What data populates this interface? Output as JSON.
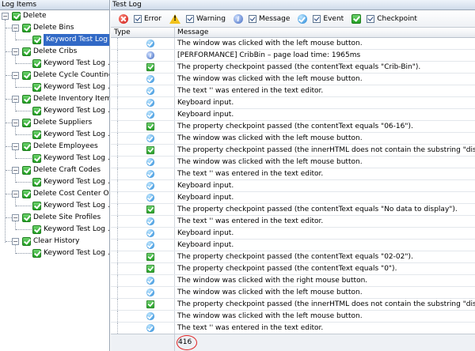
{
  "left_pane": {
    "title": "Log Items",
    "root": "Delete",
    "items": [
      {
        "label": "Delete Bins",
        "child": "Keyword Test Log ..."
      },
      {
        "label": "Delete Cribs",
        "child": "Keyword Test Log ..."
      },
      {
        "label": "Delete Cycle Counting ...",
        "child": "Keyword Test Log ..."
      },
      {
        "label": "Delete Inventory Items",
        "child": "Keyword Test Log ..."
      },
      {
        "label": "Delete Suppliers",
        "child": "Keyword Test Log ..."
      },
      {
        "label": "Delete Employees",
        "child": "Keyword Test Log ..."
      },
      {
        "label": "Delete Craft Codes",
        "child": "Keyword Test Log ..."
      },
      {
        "label": "Delete Cost Center Ones",
        "child": "Keyword Test Log ..."
      },
      {
        "label": "Delete Site Profiles",
        "child": "Keyword Test Log ..."
      },
      {
        "label": "Clear History",
        "child": "Keyword Test Log ..."
      }
    ],
    "selected_index": 0
  },
  "right_pane": {
    "title": "Test Log",
    "filters": [
      {
        "label": "Error",
        "icon": "error-icon",
        "checked": true
      },
      {
        "label": "Warning",
        "icon": "warning-icon",
        "checked": true
      },
      {
        "label": "Message",
        "icon": "message-icon",
        "checked": true
      },
      {
        "label": "Event",
        "icon": "event-icon",
        "checked": true
      },
      {
        "label": "Checkpoint",
        "icon": "checkpoint-icon",
        "checked": true
      }
    ],
    "columns": {
      "type": "Type",
      "message": "Message"
    },
    "rows": [
      {
        "type": "event",
        "message": "The window was clicked with the left mouse button."
      },
      {
        "type": "message",
        "message": "[PERFORMANCE] CribBin – page load time: 1965ms"
      },
      {
        "type": "checkpoint",
        "message": "The property checkpoint passed (the contentText equals \"Crib-Bin\")."
      },
      {
        "type": "event",
        "message": "The window was clicked with the left mouse button."
      },
      {
        "type": "event",
        "message": "The text '' was entered in the text editor."
      },
      {
        "type": "event",
        "message": "Keyboard input."
      },
      {
        "type": "event",
        "message": "Keyboard input."
      },
      {
        "type": "checkpoint",
        "message": "The property checkpoint passed (the contentText equals \"06-16\")."
      },
      {
        "type": "event",
        "message": "The window was clicked with the left mouse button."
      },
      {
        "type": "checkpoint",
        "message": "The property checkpoint passed (the innerHTML does not contain the substring \"disabled\")."
      },
      {
        "type": "event",
        "message": "The window was clicked with the left mouse button."
      },
      {
        "type": "event",
        "message": "The text '' was entered in the text editor."
      },
      {
        "type": "event",
        "message": "Keyboard input."
      },
      {
        "type": "event",
        "message": "Keyboard input."
      },
      {
        "type": "checkpoint",
        "message": "The property checkpoint passed (the contentText equals \"No data to display\")."
      },
      {
        "type": "event",
        "message": "The text '' was entered in the text editor."
      },
      {
        "type": "event",
        "message": "Keyboard input."
      },
      {
        "type": "event",
        "message": "Keyboard input."
      },
      {
        "type": "checkpoint",
        "message": "The property checkpoint passed (the contentText equals \"02-02\")."
      },
      {
        "type": "checkpoint",
        "message": "The property checkpoint passed (the contentText equals \"0\")."
      },
      {
        "type": "event",
        "message": "The window was clicked with the right mouse button."
      },
      {
        "type": "event",
        "message": "The window was clicked with the left mouse button."
      },
      {
        "type": "checkpoint",
        "message": "The property checkpoint passed (the innerHTML does not contain the substring \"disabled\")."
      },
      {
        "type": "event",
        "message": "The window was clicked with the left mouse button."
      },
      {
        "type": "event",
        "message": "The text '' was entered in the text editor."
      }
    ],
    "total_count": "416"
  }
}
